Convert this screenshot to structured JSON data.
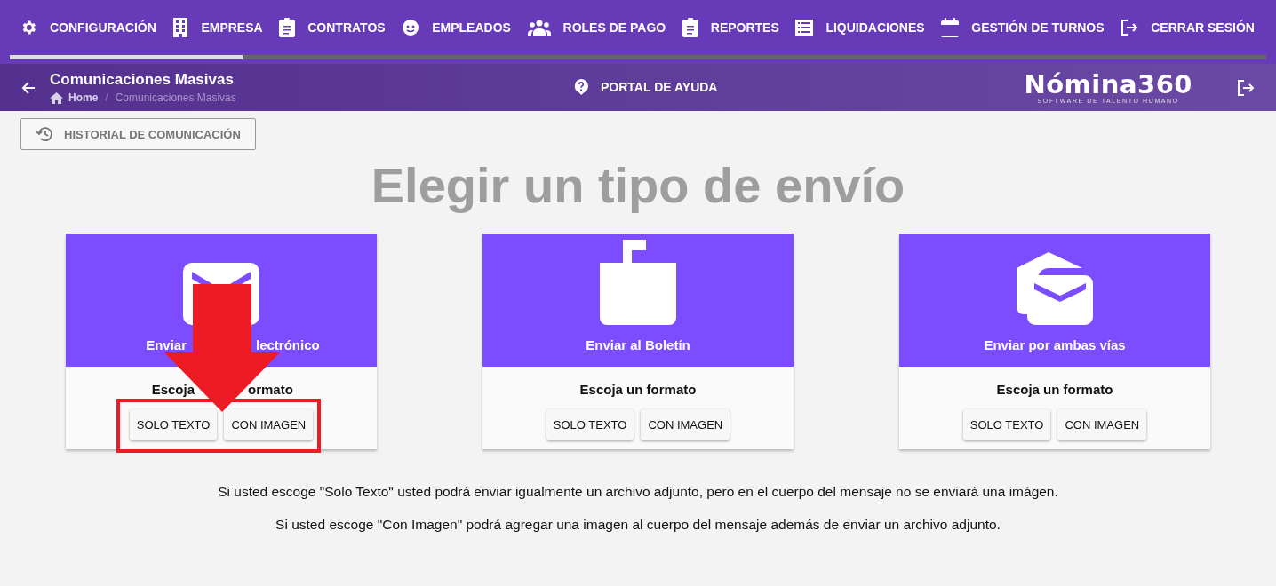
{
  "nav": {
    "items": [
      {
        "label": "CONFIGURACIÓN",
        "kind": "gear"
      },
      {
        "label": "EMPRESA",
        "kind": "building"
      },
      {
        "label": "CONTRATOS",
        "kind": "clipboard"
      },
      {
        "label": "EMPLEADOS",
        "kind": "face"
      },
      {
        "label": "ROLES DE PAGO",
        "kind": "group"
      },
      {
        "label": "REPORTES",
        "kind": "clipboard"
      },
      {
        "label": "LIQUIDACIONES",
        "kind": "list"
      },
      {
        "label": "GESTIÓN DE TURNOS",
        "kind": "calendar"
      },
      {
        "label": "CERRAR SESIÓN",
        "kind": "logout"
      }
    ],
    "progress": {
      "level": 0.185
    }
  },
  "header": {
    "title": "Comunicaciones Masivas",
    "breadcrumb": [
      {
        "label": "Home"
      },
      {
        "label": "Comunicaciones Masivas"
      }
    ],
    "breadcrumb_separator": "/",
    "help": "PORTAL DE AYUDA",
    "logo": {
      "name": "Nómina360",
      "tagline": "SOFTWARE DE TALENTO HUMANO"
    }
  },
  "history_button": "HISTORIAL DE COMUNICACIÓN",
  "heading": "Elegir un tipo de envío",
  "cards": [
    {
      "title": [
        "Enviar",
        "lectrónico"
      ],
      "kind": "mail",
      "subtitle": [
        "Escoja",
        "ormato"
      ],
      "buttons": [
        "SOLO TEXTO",
        "CON IMAGEN"
      ],
      "annotated": true
    },
    {
      "title": [
        "Enviar al Boletín"
      ],
      "kind": "mailbox",
      "subtitle": [
        "Escoja un formato"
      ],
      "buttons": [
        "SOLO TEXTO",
        "CON IMAGEN"
      ],
      "annotated": false
    },
    {
      "title": [
        "Enviar por ambas vías"
      ],
      "kind": "both",
      "subtitle": [
        "Escoja un formato"
      ],
      "buttons": [
        "SOLO TEXTO",
        "CON IMAGEN"
      ],
      "annotated": false
    }
  ],
  "notes": [
    "Si usted escoge \"Solo Texto\" usted podrá enviar igualmente un archivo adjunto, pero en el cuerpo del mensaje no se enviará una imágen.",
    "Si usted escoge \"Con Imagen\" podrá agregar una imagen al cuerpo del mensaje además de enviar un archivo adjunto."
  ]
}
